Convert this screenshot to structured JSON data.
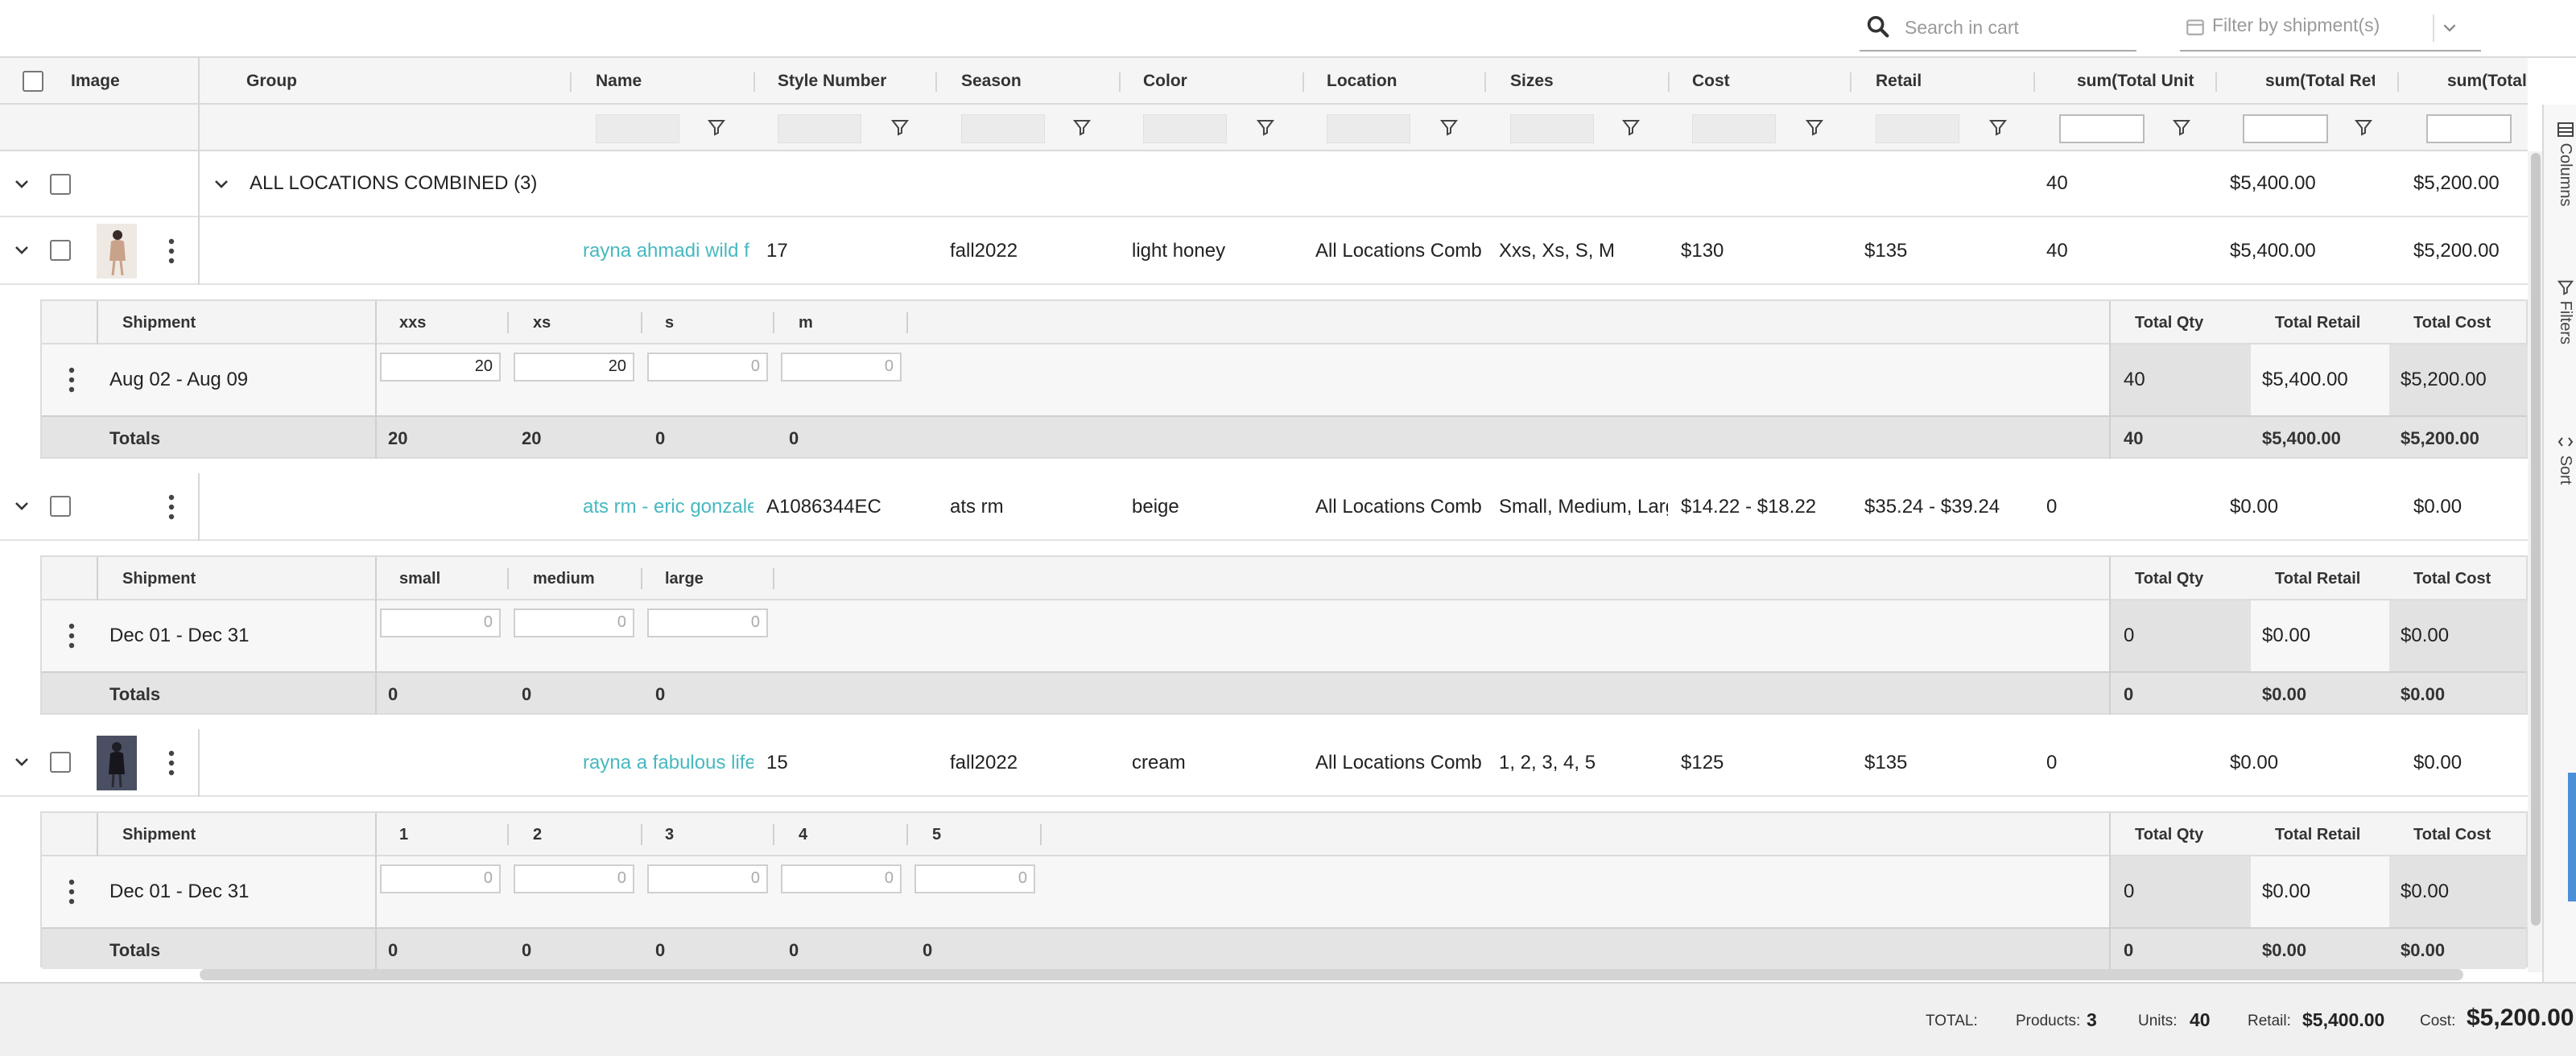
{
  "toolbar": {
    "search_placeholder": "Search in cart",
    "filter_shipment_label": "Filter by shipment(s)"
  },
  "columns": {
    "image": "Image",
    "group": "Group",
    "name": "Name",
    "style_number": "Style Number",
    "season": "Season",
    "color": "Color",
    "location": "Location",
    "sizes": "Sizes",
    "cost": "Cost",
    "retail": "Retail",
    "sum_total_units": "sum(Total Unit",
    "sum_total_retail": "sum(Total Reta",
    "sum_total_cost": "sum(Total Co"
  },
  "group": {
    "label": "ALL LOCATIONS COMBINED (3)",
    "units": "40",
    "retail": "$5,400.00",
    "cost": "$5,200.00"
  },
  "products": [
    {
      "name": "rayna ahmadi wild f",
      "style_number": "17",
      "season": "fall2022",
      "color": "light honey",
      "location": "All Locations Comb",
      "sizes": "Xxs, Xs, S, M",
      "cost": "$130",
      "retail": "$135",
      "units": "40",
      "total_retail": "$5,400.00",
      "total_cost": "$5,200.00",
      "detail": {
        "shipment_header": "Shipment",
        "size_headers": [
          "xxs",
          "xs",
          "s",
          "m"
        ],
        "shipment": "Aug 02 - Aug 09",
        "quantities": [
          "20",
          "20",
          "0",
          "0"
        ],
        "totals_label": "Totals",
        "totals": [
          "20",
          "20",
          "0",
          "0"
        ],
        "total_qty_header": "Total Qty",
        "total_retail_header": "Total Retail",
        "total_cost_header": "Total Cost",
        "row_total_qty": "40",
        "row_total_retail": "$5,400.00",
        "row_total_cost": "$5,200.00",
        "sum_total_qty": "40",
        "sum_total_retail": "$5,400.00",
        "sum_total_cost": "$5,200.00"
      }
    },
    {
      "name": "ats rm - eric gonzale",
      "style_number": "A1086344EC",
      "season": "ats rm",
      "color": "beige",
      "location": "All Locations Comb",
      "sizes": "Small, Medium, Larg",
      "cost": "$14.22 - $18.22",
      "retail": "$35.24 - $39.24",
      "units": "0",
      "total_retail": "$0.00",
      "total_cost": "$0.00",
      "detail": {
        "shipment_header": "Shipment",
        "size_headers": [
          "small",
          "medium",
          "large"
        ],
        "shipment": "Dec 01 - Dec 31",
        "quantities": [
          "0",
          "0",
          "0"
        ],
        "totals_label": "Totals",
        "totals": [
          "0",
          "0",
          "0"
        ],
        "total_qty_header": "Total Qty",
        "total_retail_header": "Total Retail",
        "total_cost_header": "Total Cost",
        "row_total_qty": "0",
        "row_total_retail": "$0.00",
        "row_total_cost": "$0.00",
        "sum_total_qty": "0",
        "sum_total_retail": "$0.00",
        "sum_total_cost": "$0.00"
      }
    },
    {
      "name": "rayna a fabulous life",
      "style_number": "15",
      "season": "fall2022",
      "color": "cream",
      "location": "All Locations Comb",
      "sizes": "1, 2, 3, 4, 5",
      "cost": "$125",
      "retail": "$135",
      "units": "0",
      "total_retail": "$0.00",
      "total_cost": "$0.00",
      "detail": {
        "shipment_header": "Shipment",
        "size_headers": [
          "1",
          "2",
          "3",
          "4",
          "5"
        ],
        "shipment": "Dec 01 - Dec 31",
        "quantities": [
          "0",
          "0",
          "0",
          "0",
          "0"
        ],
        "totals_label": "Totals",
        "totals": [
          "0",
          "0",
          "0",
          "0",
          "0"
        ],
        "total_qty_header": "Total Qty",
        "total_retail_header": "Total Retail",
        "total_cost_header": "Total Cost",
        "row_total_qty": "0",
        "row_total_retail": "$0.00",
        "row_total_cost": "$0.00",
        "sum_total_qty": "0",
        "sum_total_retail": "$0.00",
        "sum_total_cost": "$0.00"
      }
    }
  ],
  "side_panel": {
    "columns": "Columns",
    "filters": "Filters",
    "sort": "Sort"
  },
  "footer": {
    "total_label": "TOTAL:",
    "products_label": "Products:",
    "products_value": "3",
    "units_label": "Units:",
    "units_value": "40",
    "retail_label": "Retail:",
    "retail_value": "$5,400.00",
    "cost_label": "Cost:",
    "cost_value": "$5,200.00"
  },
  "colors": {
    "link": "#47b8c0",
    "header_bg": "#f5f5f5",
    "totals_bg": "#e4e4e4"
  }
}
